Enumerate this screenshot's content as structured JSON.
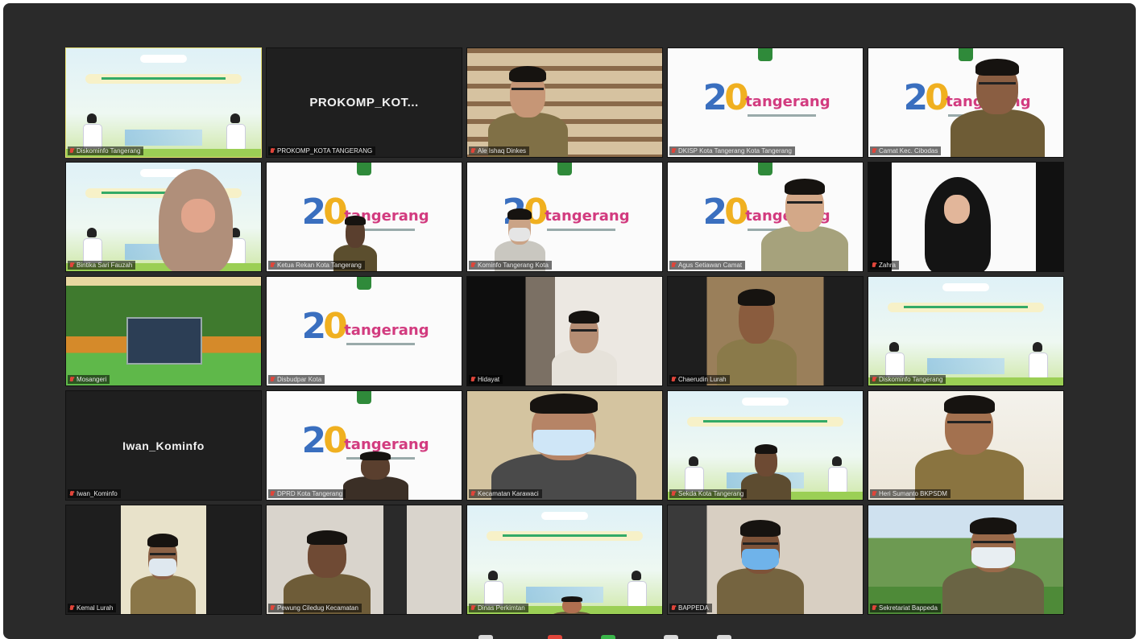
{
  "meeting": {
    "tiles": [
      {
        "name": "Diskominfo Tangerang",
        "kind": "banner",
        "active": true,
        "mic_muted": true
      },
      {
        "name": "PROKOMP_KOTA TANGERANG",
        "display_name": "PROKOMP_KOT...",
        "kind": "name",
        "mic_muted": true
      },
      {
        "name": "Ale Ishaq Dinkes",
        "kind": "video",
        "scene": "library",
        "mic_muted": true
      },
      {
        "name": "DKISP Kota Tangerang Kota Tangerang",
        "kind": "logo",
        "mic_muted": true
      },
      {
        "name": "Camat Kec. Cibodas",
        "kind": "logo-person",
        "mic_muted": true
      },
      {
        "name": "Bintika Sari Fauzah",
        "kind": "banner-person",
        "mic_muted": true
      },
      {
        "name": "Ketua Rekan Kota Tangerang",
        "kind": "logo-person",
        "mic_muted": true
      },
      {
        "name": "Kominfo Tangerang Kota",
        "kind": "logo-person",
        "mic_muted": true
      },
      {
        "name": "Agus Setiawan Camat",
        "kind": "logo-person",
        "mic_muted": true
      },
      {
        "name": "Zahra",
        "kind": "video",
        "scene": "hijab",
        "mic_muted": true
      },
      {
        "name": "Mosangeri",
        "kind": "video",
        "scene": "garden",
        "mic_muted": true
      },
      {
        "name": "Disbudpar Kota",
        "kind": "logo",
        "mic_muted": true
      },
      {
        "name": "Hidayat",
        "kind": "video",
        "scene": "dark",
        "mic_muted": true
      },
      {
        "name": "Chaerudin Lurah",
        "kind": "video",
        "scene": "portrait",
        "mic_muted": true
      },
      {
        "name": "Diskominfo Tangerang",
        "kind": "banner",
        "mic_muted": true
      },
      {
        "name": "Iwan_Kominfo",
        "display_name": "Iwan_Kominfo",
        "kind": "name",
        "mic_muted": true
      },
      {
        "name": "DPRD Kota Tangerang",
        "kind": "logo-person",
        "mic_muted": true
      },
      {
        "name": "Kecamatan Karawaci",
        "kind": "video",
        "scene": "closeup",
        "mic_muted": true
      },
      {
        "name": "Sekda Kota Tangerang",
        "kind": "banner-person",
        "mic_muted": true
      },
      {
        "name": "Heri Sumanto BKPSDM",
        "kind": "video",
        "scene": "smile",
        "mic_muted": true
      },
      {
        "name": "Kemal Lurah",
        "kind": "video",
        "scene": "mask-office",
        "mic_muted": true
      },
      {
        "name": "Pewung Ciledug Kecamatan",
        "kind": "video",
        "scene": "office",
        "mic_muted": true
      },
      {
        "name": "Dinas Perkimtan",
        "kind": "banner-person",
        "mic_muted": true
      },
      {
        "name": "BAPPEDA",
        "kind": "video",
        "scene": "mask-blue",
        "mic_muted": true
      },
      {
        "name": "Sekretariat Bappeda",
        "kind": "video",
        "scene": "outdoor-mask",
        "mic_muted": true
      }
    ],
    "logo": {
      "number_main": "2",
      "number_accent": "0",
      "word": "tangerang"
    },
    "colors": {
      "active_border": "#e8e070",
      "background": "#2a2a2a",
      "mic_muted": "#e0453a"
    },
    "toolbar": {
      "icons": [
        "mic-icon",
        "video-icon",
        "share-icon",
        "chat-icon",
        "more-icon"
      ]
    }
  }
}
